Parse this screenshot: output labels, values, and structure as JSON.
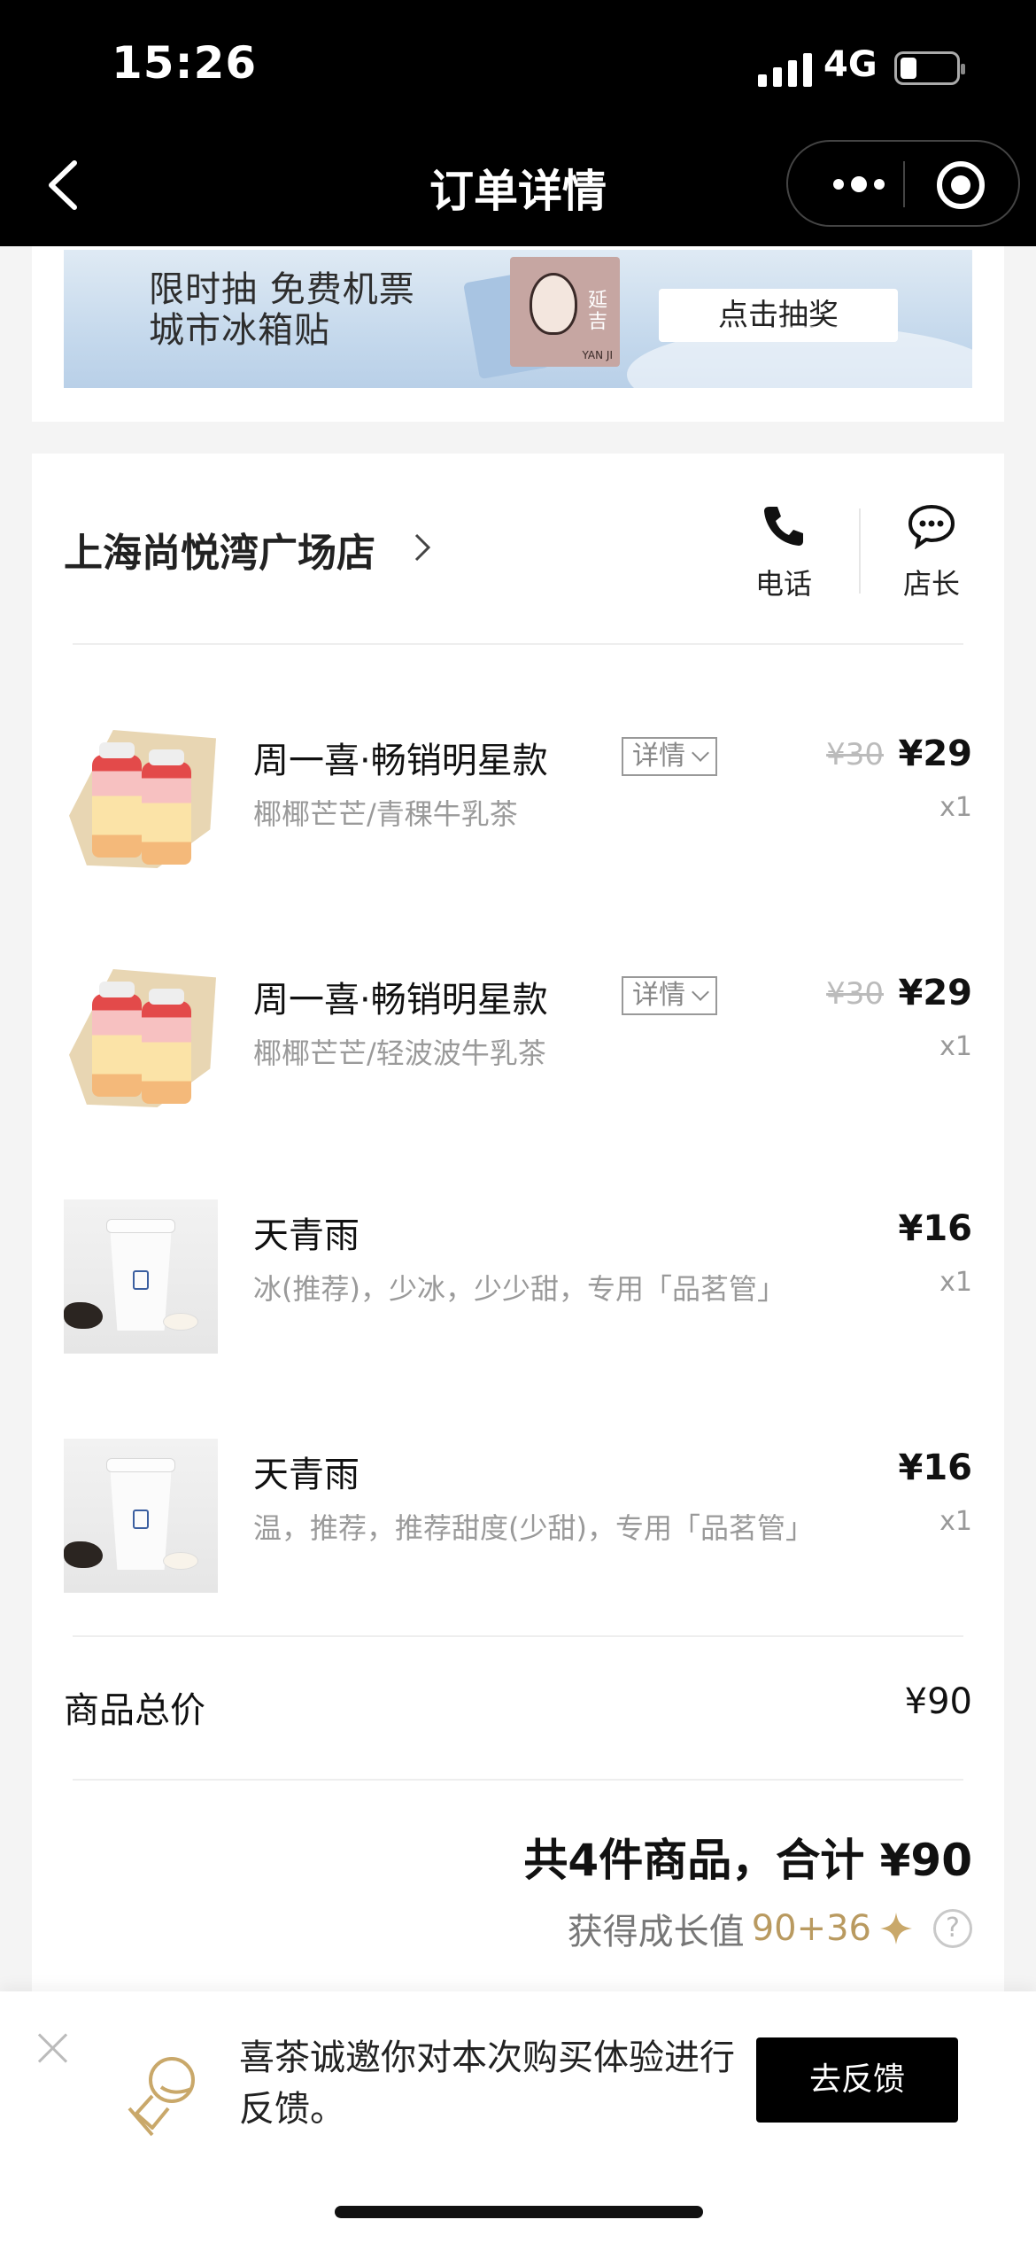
{
  "status_bar": {
    "time": "15:26",
    "network": "4G"
  },
  "nav": {
    "title": "订单详情"
  },
  "banner": {
    "line1": "限时抽 免费机票",
    "line2": "城市冰箱贴",
    "sticker_text": "延吉",
    "sticker_foot": "YAN JI",
    "button": "点击抽奖"
  },
  "store": {
    "name": "上海尚悦湾广场店",
    "phone_label": "电话",
    "manager_label": "店长"
  },
  "items": [
    {
      "name": "周一喜·畅销明星款",
      "detail": "详情",
      "spec": "椰椰芒芒/青稞牛乳茶",
      "old_price": "¥30",
      "price": "¥29",
      "qty": "x1"
    },
    {
      "name": "周一喜·畅销明星款",
      "detail": "详情",
      "spec": "椰椰芒芒/轻波波牛乳茶",
      "old_price": "¥30",
      "price": "¥29",
      "qty": "x1"
    },
    {
      "name": "天青雨",
      "spec": "冰(推荐)，少冰，少少甜，专用「品茗管」",
      "price": "¥16",
      "qty": "x1"
    },
    {
      "name": "天青雨",
      "spec": "温，推荐，推荐甜度(少甜)，专用「品茗管」",
      "price": "¥16",
      "qty": "x1"
    }
  ],
  "totals": {
    "label": "商品总价",
    "value": "¥90",
    "summary": "共4件商品，合计 ¥90",
    "growth_label": "获得成长值",
    "growth_value": "90+36",
    "help": "?"
  },
  "feedback": {
    "text": "喜茶诚邀你对本次购买体验进行反馈。",
    "button": "去反馈"
  },
  "colors": {
    "accent_gold": "#b99a60",
    "nav_bg": "#000000"
  }
}
